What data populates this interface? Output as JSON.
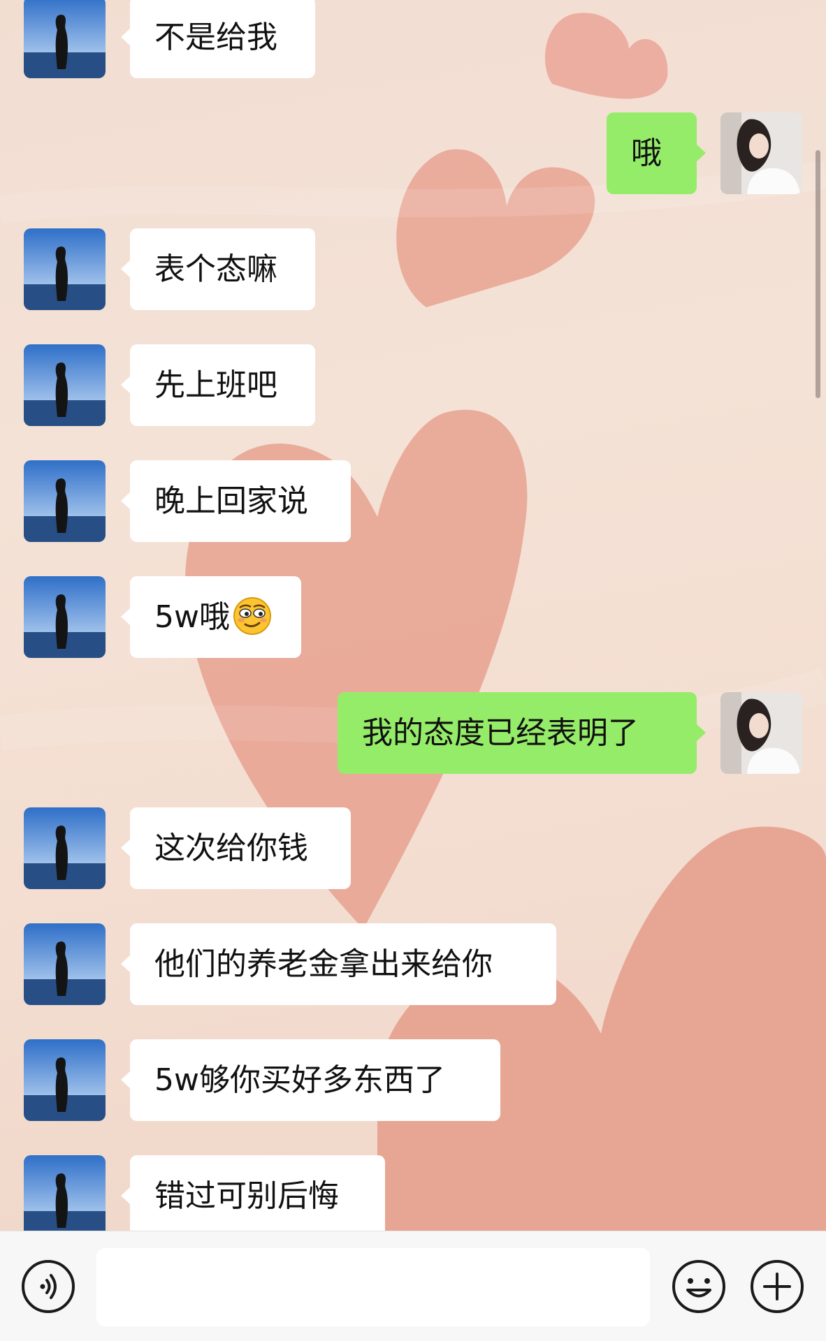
{
  "chat": {
    "messages": [
      {
        "side": "in",
        "text": "不是给我"
      },
      {
        "side": "out",
        "text": "哦"
      },
      {
        "side": "in",
        "text": "表个态嘛"
      },
      {
        "side": "in",
        "text": "先上班吧"
      },
      {
        "side": "in",
        "text": "晚上回家说"
      },
      {
        "side": "in",
        "text": "5w哦",
        "emoji": "smirk-face-emoji"
      },
      {
        "side": "out",
        "text": "我的态度已经表明了"
      },
      {
        "side": "in",
        "text": "这次给你钱"
      },
      {
        "side": "in",
        "text": "他们的养老金拿出来给你"
      },
      {
        "side": "in",
        "text": "5w够你买好多东西了"
      },
      {
        "side": "in",
        "text": "错过可别后悔"
      }
    ]
  },
  "input_bar": {
    "voice_icon": "voice-icon",
    "input_value": "",
    "emoji_icon": "emoji-icon",
    "more_icon": "plus-icon"
  },
  "colors": {
    "bubble_in": "#ffffff",
    "bubble_out": "#95ec69",
    "heart": "#e8a392",
    "background": "#f3dfd3"
  }
}
